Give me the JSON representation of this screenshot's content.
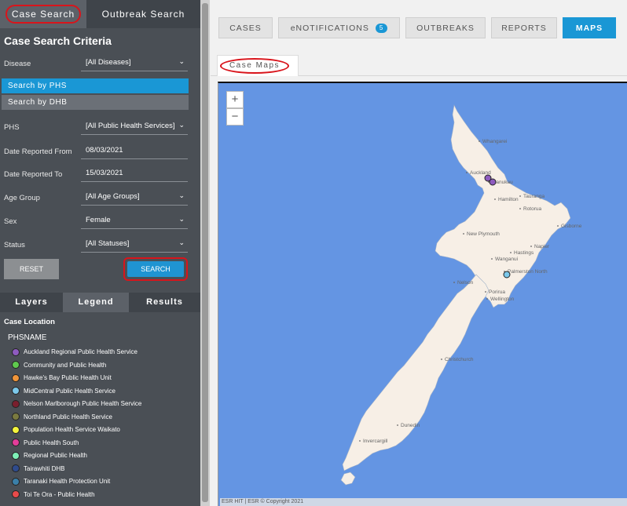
{
  "sidebar": {
    "tabs": [
      {
        "label": "Case Search"
      },
      {
        "label": "Outbreak Search"
      }
    ],
    "criteria_title": "Case Search Criteria",
    "disease": {
      "label": "Disease",
      "value": "[All Diseases]"
    },
    "search_by": [
      {
        "label": "Search by PHS"
      },
      {
        "label": "Search by DHB"
      }
    ],
    "phs": {
      "label": "PHS",
      "value": "[All Public Health Services]"
    },
    "date_from": {
      "label": "Date Reported From",
      "value": "08/03/2021"
    },
    "date_to": {
      "label": "Date Reported To",
      "value": "15/03/2021"
    },
    "age_group": {
      "label": "Age Group",
      "value": "[All Age Groups]"
    },
    "sex": {
      "label": "Sex",
      "value": "Female"
    },
    "status": {
      "label": "Status",
      "value": "[All Statuses]"
    },
    "reset_label": "RESET",
    "search_label": "SEARCH",
    "lower_tabs": [
      {
        "label": "Layers"
      },
      {
        "label": "Legend"
      },
      {
        "label": "Results"
      }
    ],
    "case_location": "Case Location",
    "phsname": "PHSNAME",
    "legend": [
      {
        "label": "Auckland Regional Public Health Service",
        "color": "#8e5bbf"
      },
      {
        "label": "Community and Public Health",
        "color": "#5fc94e"
      },
      {
        "label": "Hawke's Bay Public Health Unit",
        "color": "#f0953a"
      },
      {
        "label": "MidCentral Public Health Service",
        "color": "#7cc8ea"
      },
      {
        "label": "Nelson Marlborough Public Health Service",
        "color": "#7a1f2e"
      },
      {
        "label": "Northland Public Health Service",
        "color": "#7a7a40"
      },
      {
        "label": "Population Health Service Waikato",
        "color": "#f4f43c"
      },
      {
        "label": "Public Health South",
        "color": "#e33d9a"
      },
      {
        "label": "Regional Public Health",
        "color": "#7ef0b8"
      },
      {
        "label": "Tairawhiti DHB",
        "color": "#2f4b8c"
      },
      {
        "label": "Taranaki Health Protection Unit",
        "color": "#3b7fa8"
      },
      {
        "label": "Toi Te Ora - Public Health",
        "color": "#e84b4b"
      }
    ]
  },
  "nav": {
    "cases": "CASES",
    "enotifications": "eNOTIFICATIONS",
    "enotifications_count": "5",
    "outbreaks": "OUTBREAKS",
    "reports": "REPORTS",
    "maps": "MAPS"
  },
  "map": {
    "tab_label": "Case Maps",
    "zoom_in": "+",
    "zoom_out": "−",
    "attribution": "ESR HIT | ESR © Copyright 2021",
    "colors": {
      "sea": "#6495e3",
      "land": "#f7efe6"
    },
    "cities": [
      {
        "name": "Whangarei"
      },
      {
        "name": "Auckland"
      },
      {
        "name": "Manukau"
      },
      {
        "name": "Hamilton"
      },
      {
        "name": "Tauranga"
      },
      {
        "name": "Rotorua"
      },
      {
        "name": "Gisborne"
      },
      {
        "name": "New Plymouth"
      },
      {
        "name": "Hastings"
      },
      {
        "name": "Napier"
      },
      {
        "name": "Wanganui"
      },
      {
        "name": "Palmerston North"
      },
      {
        "name": "Porirua"
      },
      {
        "name": "Wellington"
      },
      {
        "name": "Nelson"
      },
      {
        "name": "Christchurch"
      },
      {
        "name": "Dunedin"
      },
      {
        "name": "Invercargill"
      }
    ]
  }
}
